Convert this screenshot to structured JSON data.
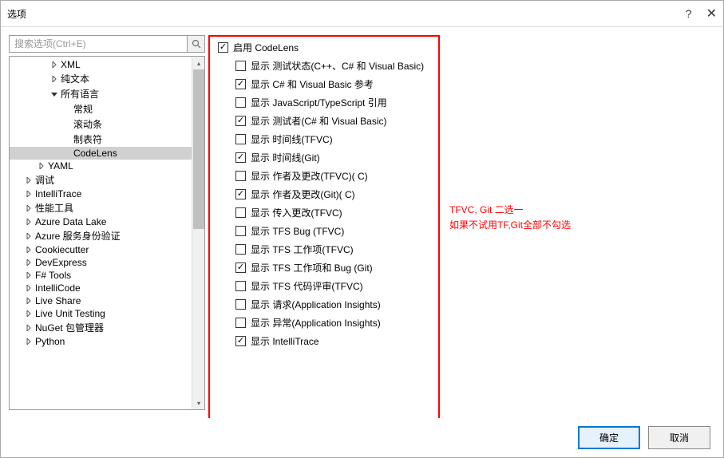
{
  "window": {
    "title": "选项"
  },
  "search": {
    "placeholder": "搜索选项(Ctrl+E)"
  },
  "tree": [
    {
      "label": "XML",
      "indent": 3,
      "arrow": "right"
    },
    {
      "label": "纯文本",
      "indent": 3,
      "arrow": "right"
    },
    {
      "label": "所有语言",
      "indent": 3,
      "arrow": "down"
    },
    {
      "label": "常规",
      "indent": 4,
      "arrow": ""
    },
    {
      "label": "滚动条",
      "indent": 4,
      "arrow": ""
    },
    {
      "label": "制表符",
      "indent": 4,
      "arrow": ""
    },
    {
      "label": "CodeLens",
      "indent": 4,
      "arrow": "",
      "selected": true
    },
    {
      "label": "YAML",
      "indent": 2,
      "arrow": "right"
    },
    {
      "label": "调试",
      "indent": 1,
      "arrow": "right"
    },
    {
      "label": "IntelliTrace",
      "indent": 1,
      "arrow": "right"
    },
    {
      "label": "性能工具",
      "indent": 1,
      "arrow": "right"
    },
    {
      "label": "Azure Data Lake",
      "indent": 1,
      "arrow": "right"
    },
    {
      "label": "Azure 服务身份验证",
      "indent": 1,
      "arrow": "right"
    },
    {
      "label": "Cookiecutter",
      "indent": 1,
      "arrow": "right"
    },
    {
      "label": "DevExpress",
      "indent": 1,
      "arrow": "right"
    },
    {
      "label": "F# Tools",
      "indent": 1,
      "arrow": "right"
    },
    {
      "label": "IntelliCode",
      "indent": 1,
      "arrow": "right"
    },
    {
      "label": "Live Share",
      "indent": 1,
      "arrow": "right"
    },
    {
      "label": "Live Unit Testing",
      "indent": 1,
      "arrow": "right"
    },
    {
      "label": "NuGet 包管理器",
      "indent": 1,
      "arrow": "right"
    },
    {
      "label": "Python",
      "indent": 1,
      "arrow": "right"
    }
  ],
  "options": {
    "master": {
      "label": "启用 CodeLens",
      "checked": true
    },
    "items": [
      {
        "label": "显示 测试状态(C++、C# 和 Visual Basic)",
        "checked": false
      },
      {
        "label": "显示 C# 和 Visual Basic 参考",
        "checked": true
      },
      {
        "label": "显示 JavaScript/TypeScript 引用",
        "checked": false
      },
      {
        "label": "显示 测试者(C# 和 Visual Basic)",
        "checked": true
      },
      {
        "label": "显示 时间线(TFVC)",
        "checked": false
      },
      {
        "label": "显示 时间线(Git)",
        "checked": true
      },
      {
        "label": "显示 作者及更改(TFVC)( C)",
        "checked": false
      },
      {
        "label": "显示 作者及更改(Git)( C)",
        "checked": true
      },
      {
        "label": "显示 传入更改(TFVC)",
        "checked": false
      },
      {
        "label": "显示 TFS Bug (TFVC)",
        "checked": false
      },
      {
        "label": "显示 TFS 工作项(TFVC)",
        "checked": false
      },
      {
        "label": "显示 TFS 工作项和 Bug (Git)",
        "checked": true
      },
      {
        "label": "显示 TFS 代码评审(TFVC)",
        "checked": false
      },
      {
        "label": "显示 请求(Application Insights)",
        "checked": false
      },
      {
        "label": "显示 异常(Application Insights)",
        "checked": false
      },
      {
        "label": "显示 IntelliTrace",
        "checked": true
      }
    ]
  },
  "annotation": {
    "line1": "TFVC, Git 二选一",
    "line2": "如果不试用TF,Git全部不勾选"
  },
  "buttons": {
    "ok": "确定",
    "cancel": "取消"
  }
}
